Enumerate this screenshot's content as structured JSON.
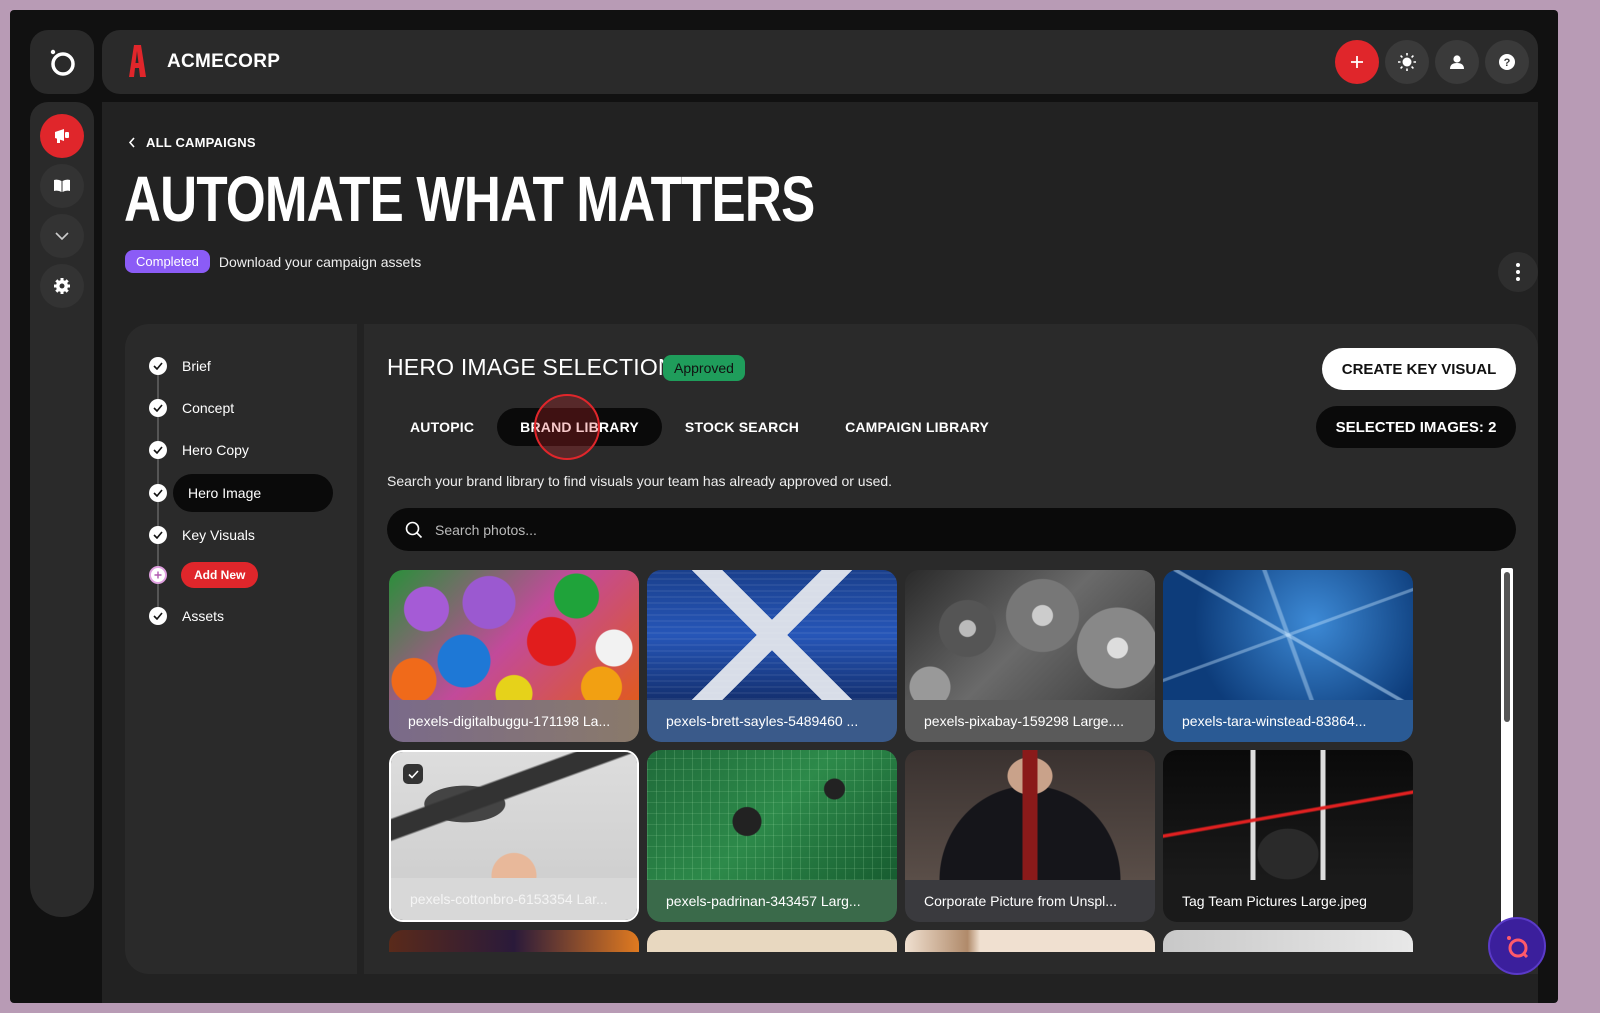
{
  "app": {
    "brand_name": "ACMECORP",
    "brand_color": "#e0262b"
  },
  "rail": {
    "items": [
      {
        "icon": "campaign-icon",
        "active": true
      },
      {
        "icon": "book-icon",
        "active": false
      },
      {
        "icon": "chevron-down-icon",
        "active": false
      },
      {
        "icon": "gear-icon",
        "active": false
      }
    ]
  },
  "topbar": {
    "actions": [
      "plus-icon",
      "sun-icon",
      "user-icon",
      "help-icon"
    ]
  },
  "page": {
    "back_label": "ALL CAMPAIGNS",
    "title": "AUTOMATE WHAT MATTERS",
    "status_badge": "Completed",
    "status_text": "Download your campaign assets"
  },
  "steps": {
    "items": [
      {
        "label": "Brief"
      },
      {
        "label": "Concept"
      },
      {
        "label": "Hero Copy"
      },
      {
        "label": "Hero Image"
      },
      {
        "label": "Key Visuals"
      },
      {
        "label": "Assets"
      }
    ],
    "add_new_label": "Add New"
  },
  "content": {
    "section_title": "HERO IMAGE SELECTION",
    "approved_badge": "Approved",
    "create_button": "CREATE KEY VISUAL",
    "selected_images": "SELECTED IMAGES: 2",
    "tabs": [
      "AUTOPIC",
      "BRAND LIBRARY",
      "STOCK SEARCH",
      "CAMPAIGN LIBRARY"
    ],
    "helper_text": "Search your brand library to find visuals your team has already approved or used.",
    "search_placeholder": "Search photos...",
    "images": [
      {
        "caption": "pexels-digitalbuggu-171198 La..."
      },
      {
        "caption": "pexels-brett-sayles-5489460 ..."
      },
      {
        "caption": "pexels-pixabay-159298 Large...."
      },
      {
        "caption": "pexels-tara-winstead-83864..."
      },
      {
        "caption": "pexels-cottonbro-6153354 Lar..."
      },
      {
        "caption": "pexels-padrinan-343457 Larg..."
      },
      {
        "caption": "Corporate Picture from Unspl..."
      },
      {
        "caption": "Tag Team Pictures Large.jpeg"
      }
    ]
  }
}
